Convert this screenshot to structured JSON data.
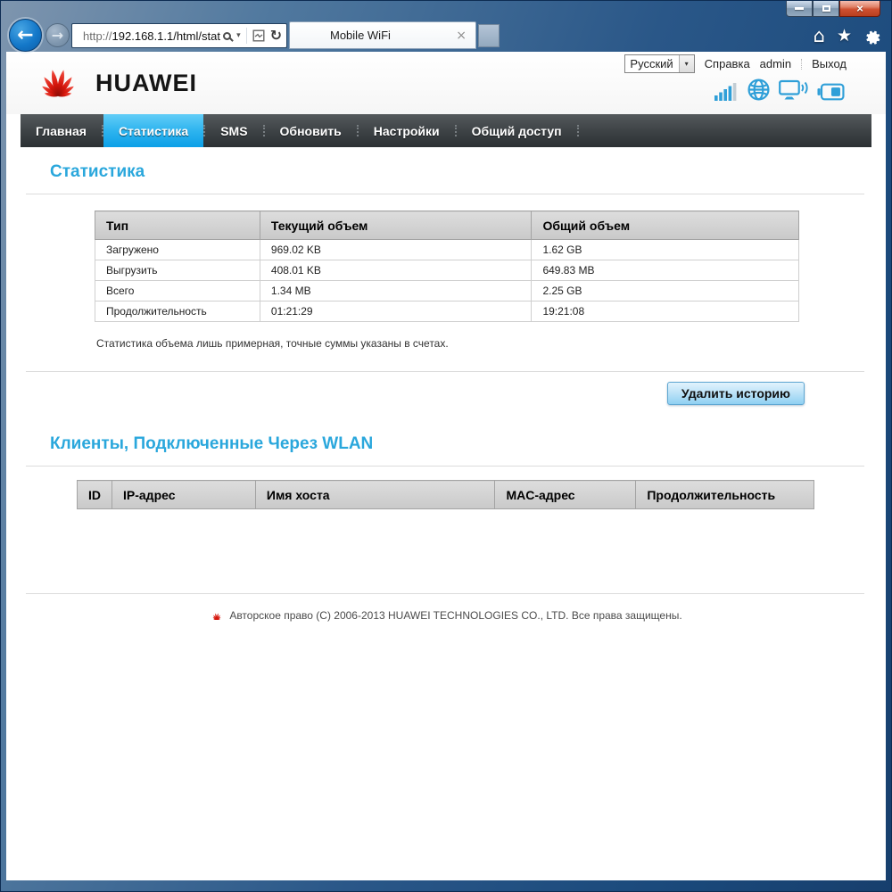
{
  "browser": {
    "url_prefix": "http://",
    "url_rest": "192.168.1.1/html/stat",
    "tab_title": "Mobile WiFi",
    "icons": {
      "back": "←",
      "forward": "→",
      "caret_down": "▾",
      "refresh": "↻",
      "tab_close": "×",
      "window_close": "×",
      "home": "⌂",
      "star": "★"
    }
  },
  "header": {
    "brand": "HUAWEI",
    "language_selected": "Русский",
    "help_link": "Справка",
    "user": "admin",
    "logout_link": "Выход"
  },
  "nav": {
    "items": [
      {
        "label": "Главная",
        "active": false
      },
      {
        "label": "Статистика",
        "active": true
      },
      {
        "label": "SMS",
        "active": false
      },
      {
        "label": "Обновить",
        "active": false
      },
      {
        "label": "Настройки",
        "active": false
      },
      {
        "label": "Общий доступ",
        "active": false
      }
    ]
  },
  "stats": {
    "title": "Статистика",
    "headers": [
      "Тип",
      "Текущий объем",
      "Общий объем"
    ],
    "rows": [
      [
        "Загружено",
        "969.02 KB",
        "1.62 GB"
      ],
      [
        "Выгрузить",
        "408.01 KB",
        "649.83 MB"
      ],
      [
        "Всего",
        "1.34 MB",
        "2.25 GB"
      ],
      [
        "Продолжительность",
        "01:21:29",
        "19:21:08"
      ]
    ],
    "note": "Статистика объема лишь примерная, точные суммы указаны в счетах.",
    "clear_button": "Удалить историю"
  },
  "clients": {
    "title": "Клиенты, Подключенные Через WLAN",
    "headers": [
      "ID",
      "IP-адрес",
      "Имя хоста",
      "MAC-адрес",
      "Продолжительность"
    ],
    "rows": []
  },
  "footer": {
    "copyright": "Авторское право (C) 2006-2013 HUAWEI TECHNOLOGIES CO., LTD. Все права защищены."
  }
}
